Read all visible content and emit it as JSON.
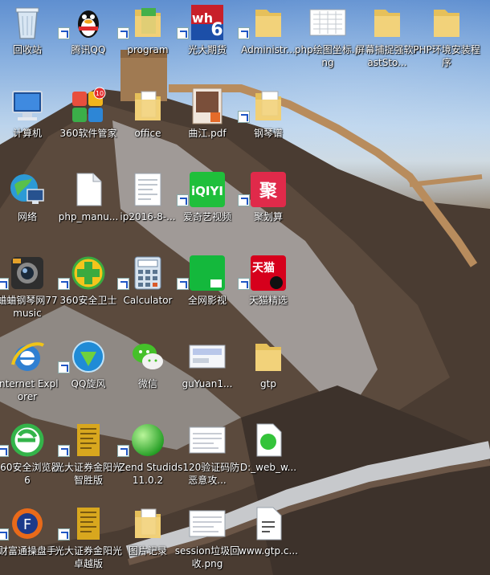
{
  "desktop": {
    "icons": [
      {
        "label": "回收站",
        "icon": "recycle-bin-icon"
      },
      {
        "label": "腾讯QQ",
        "icon": "qq-penguin-icon"
      },
      {
        "label": "program",
        "icon": "folder-icon"
      },
      {
        "label": "光大期货",
        "icon": "wh6-icon"
      },
      {
        "label": "Administr...",
        "icon": "folder-icon"
      },
      {
        "label": "php绘图坐标.png",
        "icon": "image-file-icon"
      },
      {
        "label": "屏幕捕捉强软FastSto...",
        "icon": "folder-icon"
      },
      {
        "label": "PHP环境安装程序",
        "icon": "folder-icon"
      },
      {
        "label": "计算机",
        "icon": "computer-icon"
      },
      {
        "label": "360软件管家",
        "icon": "360-software-manager-icon"
      },
      {
        "label": "office",
        "icon": "folder-icon"
      },
      {
        "label": "曲江.pdf",
        "icon": "pdf-file-icon"
      },
      {
        "label": "钢琴谱",
        "icon": "folder-icon"
      },
      {
        "label": "网络",
        "icon": "network-icon"
      },
      {
        "label": "php_manu...",
        "icon": "blank-file-icon"
      },
      {
        "label": "ip2016-8-...",
        "icon": "document-file-icon"
      },
      {
        "label": "爱奇艺视频",
        "icon": "iqiyi-icon"
      },
      {
        "label": "聚划算",
        "icon": "juhuasuan-icon"
      },
      {
        "label": "蛐蛐钢琴网77music",
        "icon": "camera-app-icon"
      },
      {
        "label": "360安全卫士",
        "icon": "360-safe-icon"
      },
      {
        "label": "Calculator",
        "icon": "calculator-icon"
      },
      {
        "label": "全网影视",
        "icon": "quanwang-video-icon"
      },
      {
        "label": "天猫精选",
        "icon": "tmall-icon"
      },
      {
        "label": "Internet Explorer",
        "icon": "internet-explorer-icon"
      },
      {
        "label": "QQ旋风",
        "icon": "qq-whirlwind-icon"
      },
      {
        "label": "微信",
        "icon": "wechat-icon"
      },
      {
        "label": "guYuan1...",
        "icon": "image-file-icon"
      },
      {
        "label": "gtp",
        "icon": "folder-icon"
      },
      {
        "label": "360安全浏览器6",
        "icon": "360-browser-icon"
      },
      {
        "label": "光大证券金阳光智胜版",
        "icon": "securities-app-icon"
      },
      {
        "label": "Zend Studio 11.0.2",
        "icon": "zend-studio-icon"
      },
      {
        "label": "ls120验证码防恶意攻...",
        "icon": "image-file-icon"
      },
      {
        "label": "D:_web_w...",
        "icon": "green-orb-file-icon"
      },
      {
        "label": "财富通操盘手",
        "icon": "caifutong-icon"
      },
      {
        "label": "光大证券金阳光卓越版",
        "icon": "securities-app-icon"
      },
      {
        "label": "图片记录",
        "icon": "folder-icon"
      },
      {
        "label": "session垃圾回收.png",
        "icon": "image-file-icon"
      },
      {
        "label": "www.gtp.c...",
        "icon": "generic-file-icon"
      }
    ]
  }
}
